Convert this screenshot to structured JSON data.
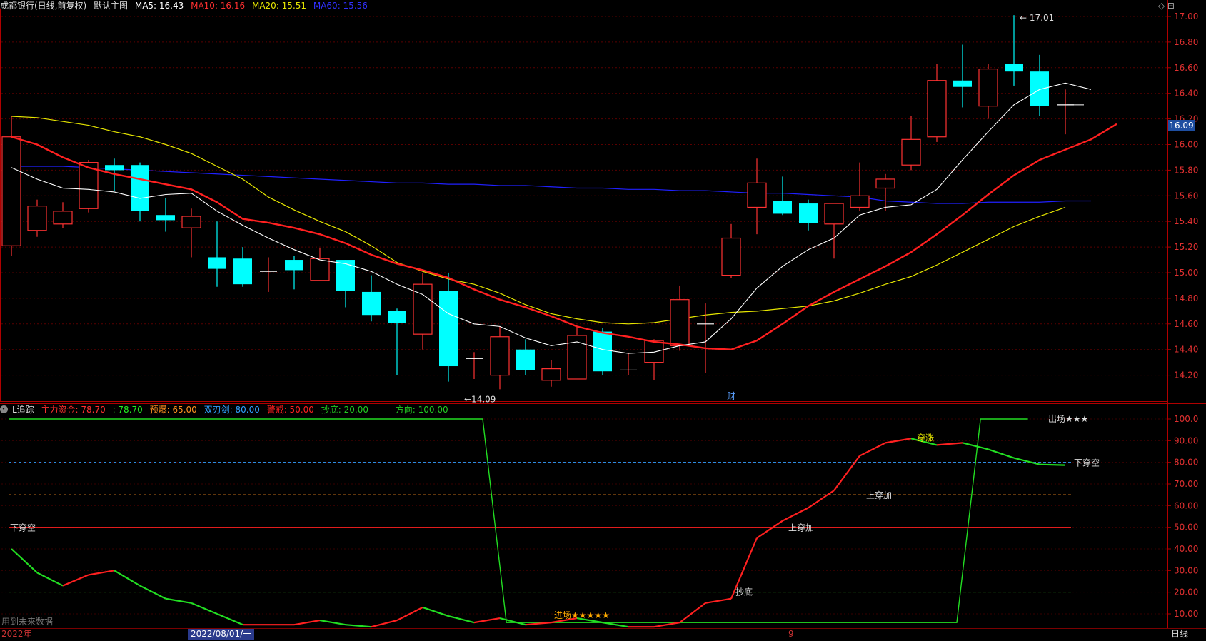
{
  "main_header": {
    "title": "成都银行(日线,前复权)",
    "chart_name": "默认主图",
    "ma5": "MA5: 16.43",
    "ma10": "MA10: 16.16",
    "ma20": "MA20: 15.51",
    "ma60": "MA60: 15.56"
  },
  "indicator_header": {
    "name": "L追踪",
    "zhuli": "主力资金: 78.70",
    "zhuli2": ": 78.70",
    "yubao": "预爆: 65.00",
    "shuangren": "双刃剑: 80.00",
    "jingjie": "警戒: 50.00",
    "chaodi": "抄底: 20.00",
    "fangxiang": "方向: 100.00"
  },
  "top_icons": "◇ ⊟",
  "current_price": "16.09",
  "footer": {
    "year": "2022年",
    "selected_date": "2022/08/01/一",
    "mid_mark": "9",
    "period": "日线",
    "future_data": "用到未来数据"
  },
  "colors": {
    "up": "#ff3232",
    "down": "#00ffff",
    "ma5": "#ffffff",
    "ma10": "#ff2020",
    "ma20": "#e6e600",
    "ma60": "#2020ff",
    "indicator_red": "#ff2020",
    "indicator_green": "#22dd22",
    "axis": "#b00000"
  },
  "chart_data": [
    {
      "type": "candlestick",
      "title": "成都银行(日线,前复权)",
      "y_ticks": [
        "17.00",
        "16.80",
        "16.60",
        "16.40",
        "16.20",
        "16.00",
        "15.80",
        "15.60",
        "15.40",
        "15.20",
        "15.00",
        "14.80",
        "14.60",
        "14.40",
        "14.20"
      ],
      "ylim": [
        14.05,
        17.1
      ],
      "annotations": [
        {
          "text": "17.01",
          "value": 17.01
        },
        {
          "text": "←14.09",
          "value": 14.09
        },
        {
          "text": "财"
        }
      ],
      "candles": [
        {
          "o": 15.21,
          "h": 16.22,
          "l": 15.13,
          "c": 16.06
        },
        {
          "o": 15.33,
          "h": 15.57,
          "l": 15.28,
          "c": 15.52
        },
        {
          "o": 15.38,
          "h": 15.55,
          "l": 15.35,
          "c": 15.48
        },
        {
          "o": 15.5,
          "h": 15.88,
          "l": 15.47,
          "c": 15.86
        },
        {
          "o": 15.84,
          "h": 15.89,
          "l": 15.64,
          "c": 15.8
        },
        {
          "o": 15.84,
          "h": 15.86,
          "l": 15.4,
          "c": 15.48
        },
        {
          "o": 15.45,
          "h": 15.58,
          "l": 15.32,
          "c": 15.41
        },
        {
          "o": 15.35,
          "h": 15.5,
          "l": 15.12,
          "c": 15.44
        },
        {
          "o": 15.12,
          "h": 15.4,
          "l": 14.89,
          "c": 15.03
        },
        {
          "o": 15.11,
          "h": 15.2,
          "l": 14.89,
          "c": 14.91
        },
        {
          "o": 15.01,
          "h": 15.12,
          "l": 14.85,
          "c": 15.01
        },
        {
          "o": 15.1,
          "h": 15.13,
          "l": 14.87,
          "c": 15.02
        },
        {
          "o": 14.94,
          "h": 15.19,
          "l": 14.94,
          "c": 15.11
        },
        {
          "o": 15.1,
          "h": 15.1,
          "l": 14.73,
          "c": 14.86
        },
        {
          "o": 14.85,
          "h": 14.98,
          "l": 14.62,
          "c": 14.67
        },
        {
          "o": 14.7,
          "h": 14.72,
          "l": 14.2,
          "c": 14.61
        },
        {
          "o": 14.52,
          "h": 15.0,
          "l": 14.4,
          "c": 14.91
        },
        {
          "o": 14.86,
          "h": 15.0,
          "l": 14.15,
          "c": 14.27
        },
        {
          "o": 14.33,
          "h": 14.38,
          "l": 14.17,
          "c": 14.33
        },
        {
          "o": 14.2,
          "h": 14.58,
          "l": 14.09,
          "c": 14.5
        },
        {
          "o": 14.4,
          "h": 14.48,
          "l": 14.2,
          "c": 14.24
        },
        {
          "o": 14.16,
          "h": 14.32,
          "l": 14.11,
          "c": 14.25
        },
        {
          "o": 14.17,
          "h": 14.58,
          "l": 14.17,
          "c": 14.51
        },
        {
          "o": 14.54,
          "h": 14.57,
          "l": 14.2,
          "c": 14.23
        },
        {
          "o": 14.24,
          "h": 14.37,
          "l": 14.2,
          "c": 14.24
        },
        {
          "o": 14.3,
          "h": 14.48,
          "l": 14.16,
          "c": 14.47
        },
        {
          "o": 14.43,
          "h": 14.9,
          "l": 14.39,
          "c": 14.79
        },
        {
          "o": 14.6,
          "h": 14.76,
          "l": 14.22,
          "c": 14.6
        },
        {
          "o": 14.98,
          "h": 15.38,
          "l": 14.96,
          "c": 15.27
        },
        {
          "o": 15.51,
          "h": 15.89,
          "l": 15.3,
          "c": 15.7
        },
        {
          "o": 15.56,
          "h": 15.75,
          "l": 15.45,
          "c": 15.46
        },
        {
          "o": 15.54,
          "h": 15.57,
          "l": 15.33,
          "c": 15.39
        },
        {
          "o": 15.38,
          "h": 15.52,
          "l": 15.11,
          "c": 15.54
        },
        {
          "o": 15.51,
          "h": 15.86,
          "l": 15.48,
          "c": 15.6
        },
        {
          "o": 15.66,
          "h": 15.77,
          "l": 15.48,
          "c": 15.73
        },
        {
          "o": 15.84,
          "h": 16.22,
          "l": 15.8,
          "c": 16.04
        },
        {
          "o": 16.06,
          "h": 16.63,
          "l": 16.02,
          "c": 16.5
        },
        {
          "o": 16.5,
          "h": 16.78,
          "l": 16.29,
          "c": 16.45
        },
        {
          "o": 16.3,
          "h": 16.63,
          "l": 16.2,
          "c": 16.59
        },
        {
          "o": 16.63,
          "h": 17.01,
          "l": 16.46,
          "c": 16.57
        },
        {
          "o": 16.57,
          "h": 16.7,
          "l": 16.22,
          "c": 16.3
        },
        {
          "o": 16.3,
          "h": 16.43,
          "l": 16.08,
          "c": 16.31
        }
      ],
      "ma5": [
        15.82,
        15.73,
        15.66,
        15.65,
        15.63,
        15.58,
        15.61,
        15.62,
        15.48,
        15.37,
        15.27,
        15.18,
        15.1,
        15.07,
        15.01,
        14.91,
        14.83,
        14.68,
        14.6,
        14.58,
        14.49,
        14.43,
        14.46,
        14.4,
        14.37,
        14.38,
        14.43,
        14.46,
        14.64,
        14.88,
        15.05,
        15.18,
        15.27,
        15.45,
        15.51,
        15.53,
        15.65,
        15.88,
        16.1,
        16.31,
        16.43,
        16.48,
        16.43
      ],
      "ma10": [
        16.06,
        16.0,
        15.9,
        15.82,
        15.77,
        15.73,
        15.69,
        15.65,
        15.55,
        15.42,
        15.39,
        15.35,
        15.3,
        15.23,
        15.14,
        15.07,
        15.02,
        14.96,
        14.87,
        14.79,
        14.73,
        14.66,
        14.58,
        14.53,
        14.5,
        14.46,
        14.44,
        14.41,
        14.4,
        14.47,
        14.6,
        14.74,
        14.85,
        14.95,
        15.05,
        15.16,
        15.3,
        15.45,
        15.61,
        15.76,
        15.88,
        15.96,
        16.04,
        16.16
      ],
      "ma20": [
        16.22,
        16.21,
        16.18,
        16.15,
        16.1,
        16.06,
        16.0,
        15.93,
        15.83,
        15.73,
        15.59,
        15.49,
        15.4,
        15.32,
        15.21,
        15.08,
        15.01,
        14.95,
        14.91,
        14.84,
        14.75,
        14.68,
        14.64,
        14.61,
        14.6,
        14.61,
        14.64,
        14.67,
        14.69,
        14.7,
        14.72,
        14.74,
        14.78,
        14.84,
        14.91,
        14.97,
        15.06,
        15.16,
        15.26,
        15.36,
        15.44,
        15.51
      ],
      "ma60": [
        15.83,
        15.83,
        15.83,
        15.82,
        15.81,
        15.8,
        15.79,
        15.78,
        15.77,
        15.76,
        15.75,
        15.74,
        15.73,
        15.72,
        15.71,
        15.7,
        15.7,
        15.69,
        15.69,
        15.68,
        15.68,
        15.67,
        15.66,
        15.66,
        15.65,
        15.65,
        15.64,
        15.64,
        15.63,
        15.62,
        15.62,
        15.61,
        15.6,
        15.59,
        15.56,
        15.55,
        15.54,
        15.54,
        15.55,
        15.55,
        15.55,
        15.56,
        15.56
      ]
    },
    {
      "type": "line",
      "title": "L追踪",
      "y_ticks": [
        "100.0",
        "90.00",
        "80.00",
        "70.00",
        "60.00",
        "50.00",
        "40.00",
        "30.00",
        "20.00",
        "10.00"
      ],
      "ylim": [
        5,
        102
      ],
      "annotations": [
        {
          "text": "下穿空"
        },
        {
          "text": "进场★★★★★"
        },
        {
          "text": "抄底"
        },
        {
          "text": "上穿加"
        },
        {
          "text": "上穿加"
        },
        {
          "text": "穿涨"
        },
        {
          "text": "出场★★★"
        },
        {
          "text": "下穿空"
        }
      ],
      "direction_line": [
        100,
        100,
        100,
        100,
        100,
        100,
        100,
        100,
        100,
        100,
        100,
        100,
        100,
        100,
        100,
        100,
        100,
        100,
        100,
        100,
        100,
        6,
        6,
        6,
        6,
        6,
        6,
        6,
        6,
        6,
        6,
        6,
        6,
        6,
        6,
        6,
        6,
        6,
        6,
        6,
        6,
        100,
        100,
        100
      ],
      "main_fund": [
        40,
        29,
        23,
        28,
        30,
        23,
        17,
        15,
        10,
        5,
        5,
        5,
        7,
        5,
        4,
        7,
        13,
        9,
        6,
        8,
        5,
        6,
        8,
        6,
        4,
        4,
        6,
        15,
        17,
        45,
        53,
        59,
        67,
        83,
        89,
        91,
        88,
        89,
        86,
        82,
        79,
        78.7
      ],
      "h_lines": [
        80,
        65,
        50,
        20
      ]
    }
  ]
}
